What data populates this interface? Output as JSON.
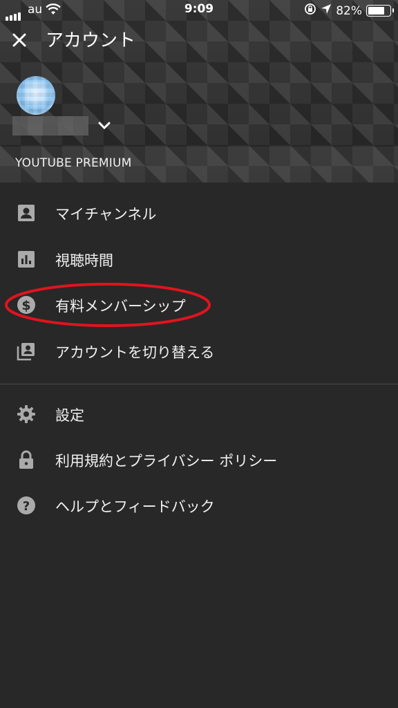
{
  "status_bar": {
    "carrier": "au",
    "time": "9:09",
    "battery_percent": "82%",
    "battery_level": 0.82
  },
  "header": {
    "title": "アカウント",
    "section_label": "YOUTUBE PREMIUM"
  },
  "menu": {
    "group1": [
      {
        "label": "マイチャンネル",
        "icon": "account-box-icon"
      },
      {
        "label": "視聴時間",
        "icon": "bar-chart-icon"
      },
      {
        "label": "有料メンバーシップ",
        "icon": "dollar-circle-icon"
      },
      {
        "label": "アカウントを切り替える",
        "icon": "switch-account-icon"
      }
    ],
    "group2": [
      {
        "label": "設定",
        "icon": "gear-icon"
      },
      {
        "label": "利用規約とプライバシー ポリシー",
        "icon": "lock-icon"
      },
      {
        "label": "ヘルプとフィードバック",
        "icon": "help-icon"
      }
    ]
  },
  "colors": {
    "background": "#282828",
    "icon": "#aaaaaa",
    "highlight": "#e0141e"
  }
}
